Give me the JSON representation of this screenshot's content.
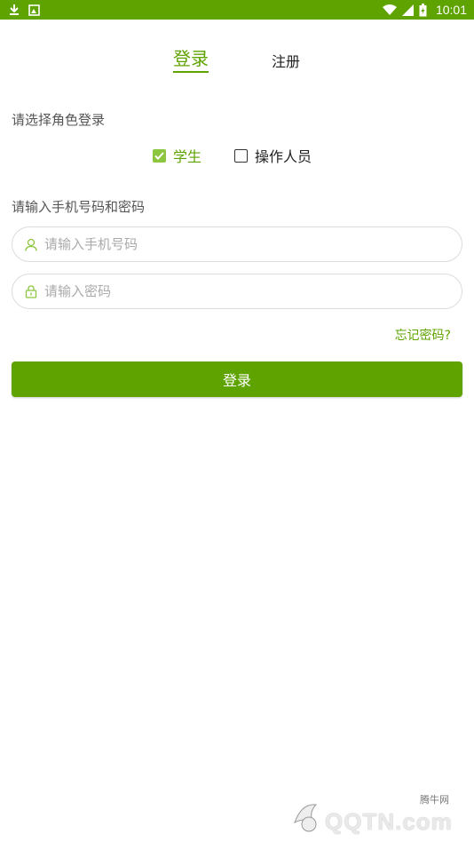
{
  "status_bar": {
    "time": "10:01",
    "left_icons": [
      "download-icon",
      "image-icon"
    ],
    "right_icons": [
      "wifi-icon",
      "signal-icon",
      "battery-icon"
    ]
  },
  "tabs": {
    "login": "登录",
    "register": "注册",
    "active": "login"
  },
  "role_section": {
    "label": "请选择角色登录",
    "options": [
      {
        "label": "学生",
        "checked": true
      },
      {
        "label": "操作人员",
        "checked": false
      }
    ]
  },
  "credentials": {
    "label": "请输入手机号码和密码",
    "phone_placeholder": "请输入手机号码",
    "phone_value": "",
    "password_placeholder": "请输入密码",
    "password_value": ""
  },
  "forgot_password": "忘记密码?",
  "login_button": "登录",
  "watermark": {
    "cn_text": "腾牛网",
    "brand_text": "QQTN.com"
  },
  "colors": {
    "accent": "#5fa300",
    "checkbox": "#8cc63f",
    "border": "#dcdcdc"
  }
}
